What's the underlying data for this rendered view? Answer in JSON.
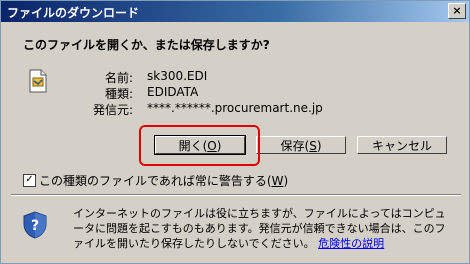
{
  "window": {
    "title": "ファイルのダウンロード",
    "close_glyph": "×"
  },
  "question": "このファイルを開くか、または保存しますか?",
  "file": {
    "icon": "edi-file-icon",
    "name_label": "名前:",
    "name_value": "sk300.EDI",
    "type_label": "種類:",
    "type_value": "EDIDATA",
    "from_label": "発信元:",
    "from_value": "****.******.procuremart.ne.jp"
  },
  "buttons": {
    "open": {
      "text": "開く(",
      "key": "O",
      "end": ")"
    },
    "save": {
      "text": "保存(",
      "key": "S",
      "end": ")"
    },
    "cancel": "キャンセル"
  },
  "checkbox": {
    "checked": true,
    "mark": "✓",
    "text": "この種類のファイルであれば常に警告する(",
    "key": "W",
    "end": ")"
  },
  "warning": {
    "icon": "shield-question-icon",
    "text": "インターネットのファイルは役に立ちますが、ファイルによってはコンピュータに問題を起こすものもあります。発信元が信頼できない場合は、このファイルを開いたり保存したりしないでください。",
    "link": "危険性の説明"
  },
  "colors": {
    "titlebar_start": "#0a246a",
    "titlebar_end": "#a6caf0",
    "dialog_bg": "#d4d0c8",
    "highlight": "#e00000",
    "link": "#0000ff"
  }
}
